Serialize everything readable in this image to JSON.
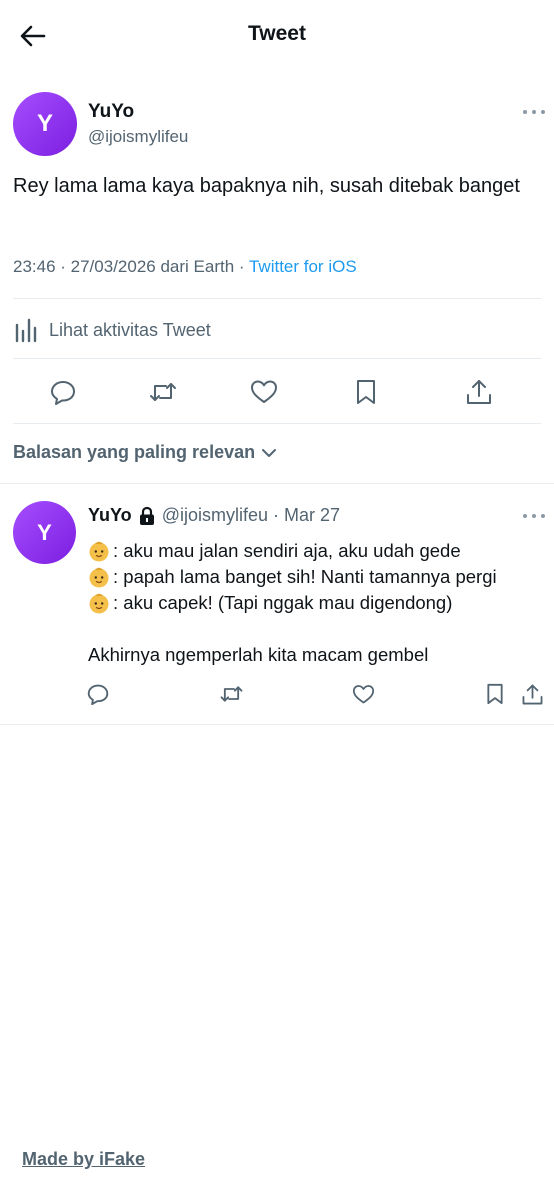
{
  "header": {
    "title": "Tweet",
    "back_icon": "arrow-left-icon"
  },
  "tweet": {
    "avatar_letter": "Y",
    "name": "YuYo",
    "handle": "@ijoismylifeu",
    "text": "Rey lama lama kaya bapaknya nih, susah ditebak banget",
    "meta_time": "23:46 · 27/03/2026 dari Earth · ",
    "meta_source": "Twitter for iOS",
    "activity_label": "Lihat aktivitas Tweet",
    "actions": [
      "reply-icon",
      "retweet-icon",
      "like-icon",
      "bookmark-icon",
      "share-icon"
    ]
  },
  "replies_sort": {
    "label": "Balasan yang paling relevan"
  },
  "reply": {
    "avatar_letter": "Y",
    "name": "YuYo",
    "handle_date": "@ijoismylifeu · Mar 27",
    "lines": [
      ": aku mau jalan sendiri aja, aku udah gede",
      ": papah lama banget sih! Nanti tamannya pergi",
      ": aku capek! (Tapi nggak mau digendong)"
    ],
    "last_line": "Akhirnya ngemperlah kita macam gembel",
    "line_emoji": "baby-face-icon"
  },
  "footer": {
    "label": "Made by iFake"
  },
  "colors": {
    "accent": "#1d9bf0",
    "muted": "#536471",
    "avatar": "#8a2be2"
  }
}
